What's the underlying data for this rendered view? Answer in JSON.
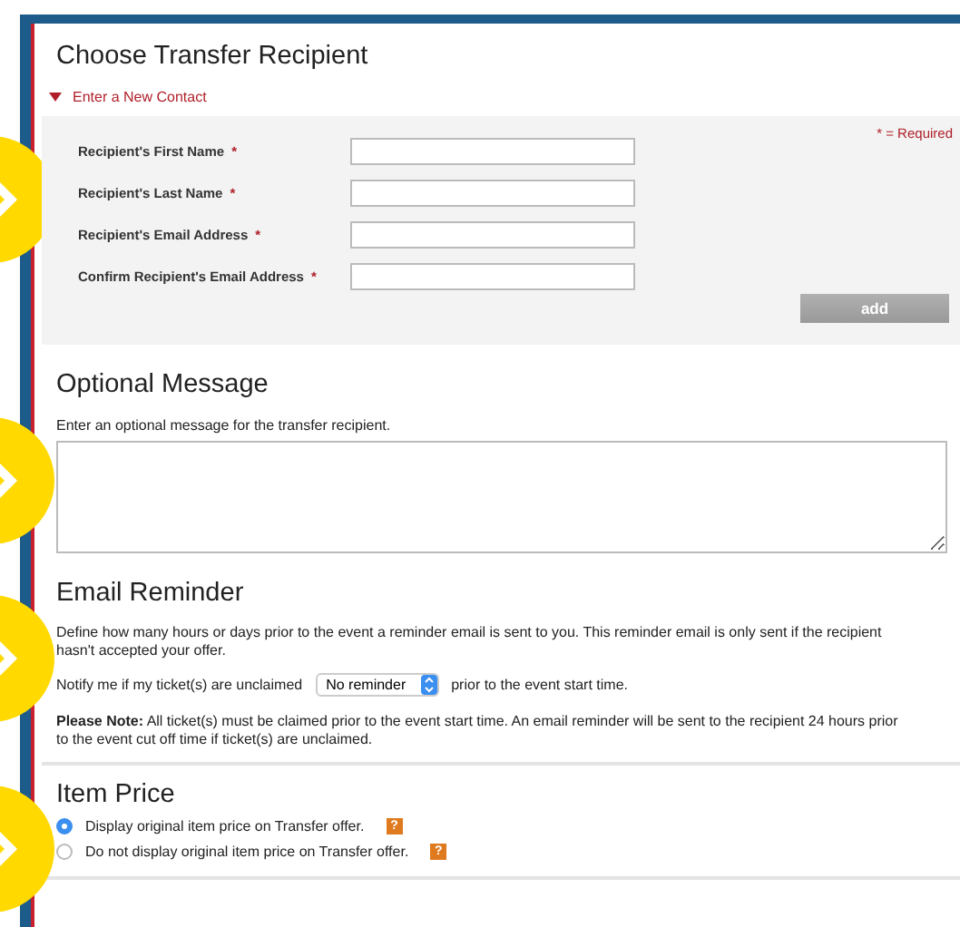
{
  "recipient": {
    "title": "Choose Transfer Recipient",
    "toggle": {
      "label": "Enter a New Contact",
      "expanded": true
    },
    "required_note": "* = Required",
    "fields": [
      {
        "label": "Recipient's First Name",
        "required_mark": "*"
      },
      {
        "label": "Recipient's Last Name",
        "required_mark": "*"
      },
      {
        "label": "Recipient's Email Address",
        "required_mark": "*"
      },
      {
        "label": "Confirm Recipient's Email Address",
        "required_mark": "*"
      }
    ],
    "add_button": "add"
  },
  "message": {
    "title": "Optional Message",
    "hint": "Enter an optional message for the transfer recipient."
  },
  "reminder": {
    "title": "Email Reminder",
    "description": "Define how many hours or days prior to the event a reminder email is sent to you. This reminder email is only sent if the recipient hasn't accepted your offer.",
    "notify_before": "Notify me if my ticket(s) are unclaimed",
    "select_value": "No reminder",
    "notify_after": "prior to the event start time.",
    "note": "**Please Note:** All ticket(s) must be claimed prior to the event start time. An email reminder will be sent to the recipient 24 hours prior to the event cut off time if ticket(s) are unclaimed."
  },
  "item_price": {
    "title": "Item Price",
    "options": [
      {
        "label": "Display original item price on Transfer offer.",
        "selected": true,
        "help": "?"
      },
      {
        "label": "Do not display original item price on Transfer offer.",
        "selected": false,
        "help": "?"
      }
    ]
  }
}
